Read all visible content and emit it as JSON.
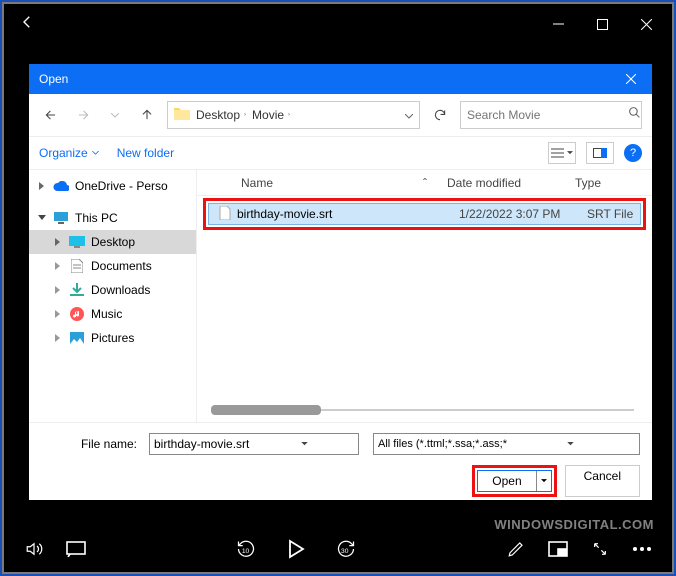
{
  "dialog": {
    "title": "Open",
    "breadcrumbs": {
      "seg1": "Desktop",
      "seg2": "Movie",
      "chev": "›"
    },
    "search_placeholder": "Search Movie",
    "toolbar": {
      "organize": "Organize",
      "newfolder": "New folder"
    },
    "tree": {
      "onedrive": "OneDrive - Perso",
      "thispc": "This PC",
      "desktop": "Desktop",
      "documents": "Documents",
      "downloads": "Downloads",
      "music": "Music",
      "pictures": "Pictures"
    },
    "columns": {
      "name": "Name",
      "date": "Date modified",
      "type": "Type"
    },
    "files": [
      {
        "name": "birthday-movie.srt",
        "date": "1/22/2022 3:07 PM",
        "type": "SRT File"
      }
    ],
    "filename_label": "File name:",
    "filename_value": "birthday-movie.srt",
    "filter": "All files (*.ttml;*.ssa;*.ass;*.srt;*.",
    "open": "Open",
    "cancel": "Cancel"
  },
  "watermark": "WINDOWSDIGITAL.COM"
}
